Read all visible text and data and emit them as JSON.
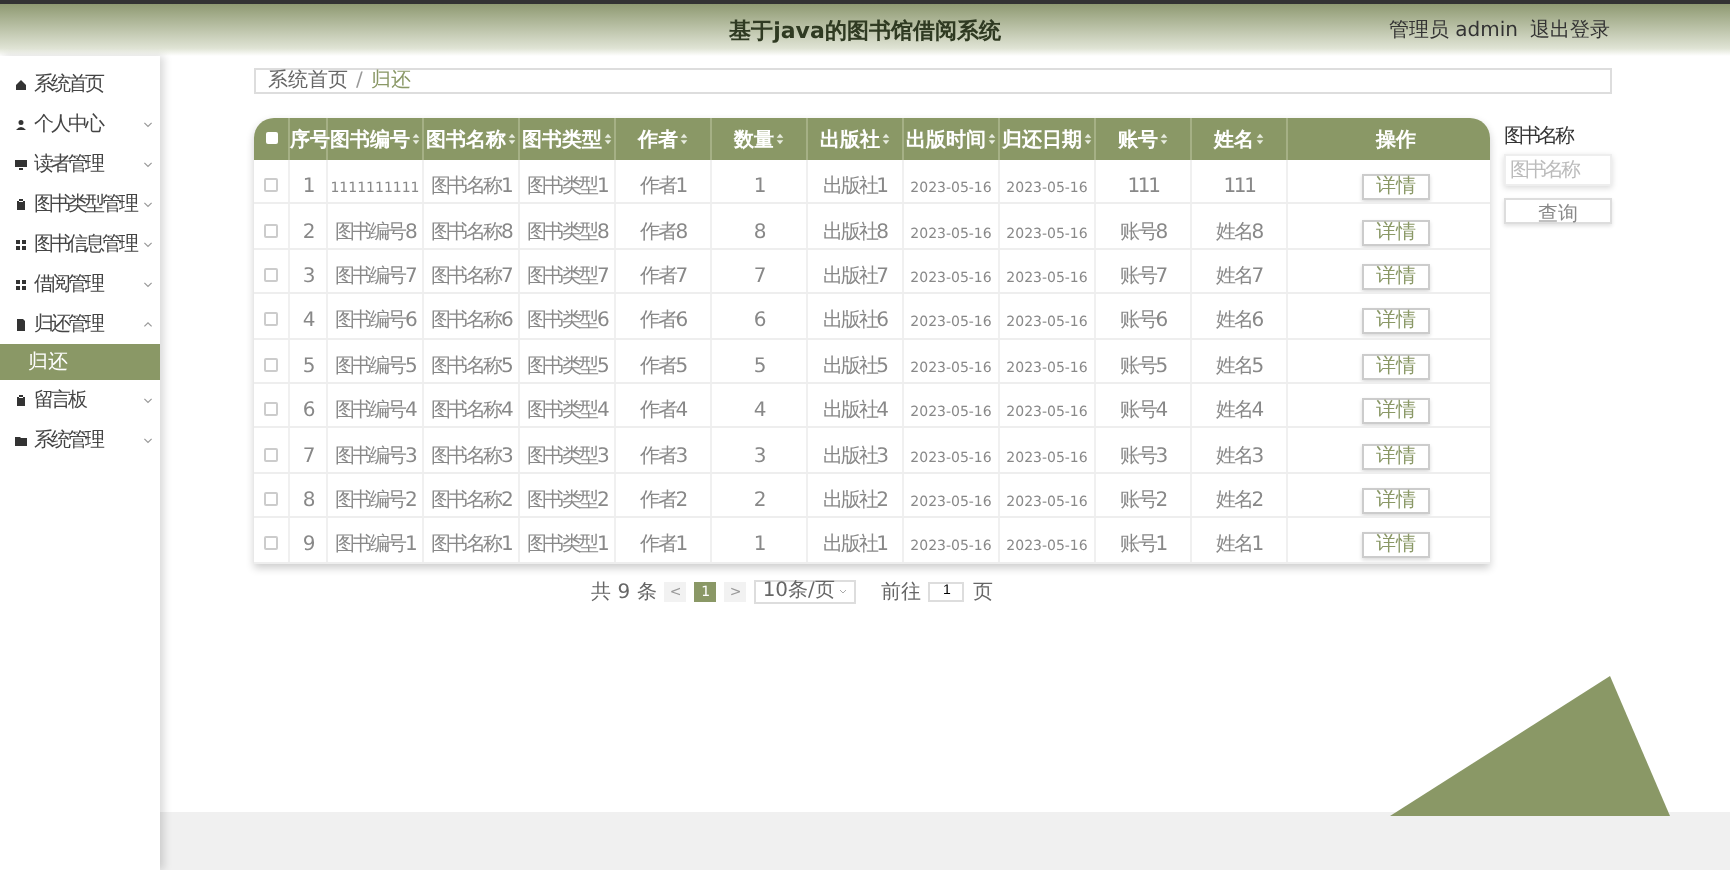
{
  "header": {
    "title": "基于java的图书馆借阅系统",
    "user": "管理员 admin",
    "logout": "退出登录"
  },
  "sidebar": {
    "items": [
      {
        "label": "系统首页"
      },
      {
        "label": "个人中心",
        "expanded": false
      },
      {
        "label": "读者管理",
        "expanded": false
      },
      {
        "label": "图书类型管理",
        "expanded": false
      },
      {
        "label": "图书信息管理",
        "expanded": false
      },
      {
        "label": "借阅管理",
        "expanded": false
      },
      {
        "label": "归还管理",
        "expanded": true,
        "children": [
          {
            "label": "归还",
            "selected": true
          }
        ]
      },
      {
        "label": "留言板",
        "expanded": false
      },
      {
        "label": "系统管理",
        "expanded": false
      }
    ]
  },
  "breadcrumb": {
    "home": "系统首页",
    "separator": "/",
    "current": "归还"
  },
  "table": {
    "select_all_checked": false,
    "columns": [
      {
        "label": "序号",
        "sortable": false
      },
      {
        "label": "图书编号",
        "sortable": true
      },
      {
        "label": "图书名称",
        "sortable": true
      },
      {
        "label": "图书类型",
        "sortable": true
      },
      {
        "label": "作者",
        "sortable": true
      },
      {
        "label": "数量",
        "sortable": true
      },
      {
        "label": "出版社",
        "sortable": true
      },
      {
        "label": "出版时间",
        "sortable": true
      },
      {
        "label": "归还日期",
        "sortable": true
      },
      {
        "label": "账号",
        "sortable": true
      },
      {
        "label": "姓名",
        "sortable": true
      },
      {
        "label": "操作",
        "sortable": false
      }
    ],
    "rows": [
      {
        "checked": false,
        "cells": [
          "1",
          "1111111111",
          "图书名称1",
          "图书类型1",
          "作者1",
          "1",
          "出版社1",
          "2023-05-16",
          "2023-05-16",
          "111",
          "111"
        ],
        "action": "详情"
      },
      {
        "checked": false,
        "cells": [
          "2",
          "图书编号8",
          "图书名称8",
          "图书类型8",
          "作者8",
          "8",
          "出版社8",
          "2023-05-16",
          "2023-05-16",
          "账号8",
          "姓名8"
        ],
        "action": "详情"
      },
      {
        "checked": false,
        "cells": [
          "3",
          "图书编号7",
          "图书名称7",
          "图书类型7",
          "作者7",
          "7",
          "出版社7",
          "2023-05-16",
          "2023-05-16",
          "账号7",
          "姓名7"
        ],
        "action": "详情"
      },
      {
        "checked": false,
        "cells": [
          "4",
          "图书编号6",
          "图书名称6",
          "图书类型6",
          "作者6",
          "6",
          "出版社6",
          "2023-05-16",
          "2023-05-16",
          "账号6",
          "姓名6"
        ],
        "action": "详情"
      },
      {
        "checked": false,
        "cells": [
          "5",
          "图书编号5",
          "图书名称5",
          "图书类型5",
          "作者5",
          "5",
          "出版社5",
          "2023-05-16",
          "2023-05-16",
          "账号5",
          "姓名5"
        ],
        "action": "详情"
      },
      {
        "checked": false,
        "cells": [
          "6",
          "图书编号4",
          "图书名称4",
          "图书类型4",
          "作者4",
          "4",
          "出版社4",
          "2023-05-16",
          "2023-05-16",
          "账号4",
          "姓名4"
        ],
        "action": "详情"
      },
      {
        "checked": false,
        "cells": [
          "7",
          "图书编号3",
          "图书名称3",
          "图书类型3",
          "作者3",
          "3",
          "出版社3",
          "2023-05-16",
          "2023-05-16",
          "账号3",
          "姓名3"
        ],
        "action": "详情"
      },
      {
        "checked": false,
        "cells": [
          "8",
          "图书编号2",
          "图书名称2",
          "图书类型2",
          "作者2",
          "2",
          "出版社2",
          "2023-05-16",
          "2023-05-16",
          "账号2",
          "姓名2"
        ],
        "action": "详情"
      },
      {
        "checked": false,
        "cells": [
          "9",
          "图书编号1",
          "图书名称1",
          "图书类型1",
          "作者1",
          "1",
          "出版社1",
          "2023-05-16",
          "2023-05-16",
          "账号1",
          "姓名1"
        ],
        "action": "详情"
      }
    ]
  },
  "pagination": {
    "total": "共 9 条",
    "prev": "<",
    "pages": [
      {
        "label": "1",
        "selected": true
      }
    ],
    "next": ">",
    "page_size": "10条/页",
    "goto": "前往",
    "goto_value": "1",
    "page_unit": "页"
  },
  "search": {
    "label": "图书名称",
    "placeholder": "图书名称",
    "button": "查询"
  }
}
